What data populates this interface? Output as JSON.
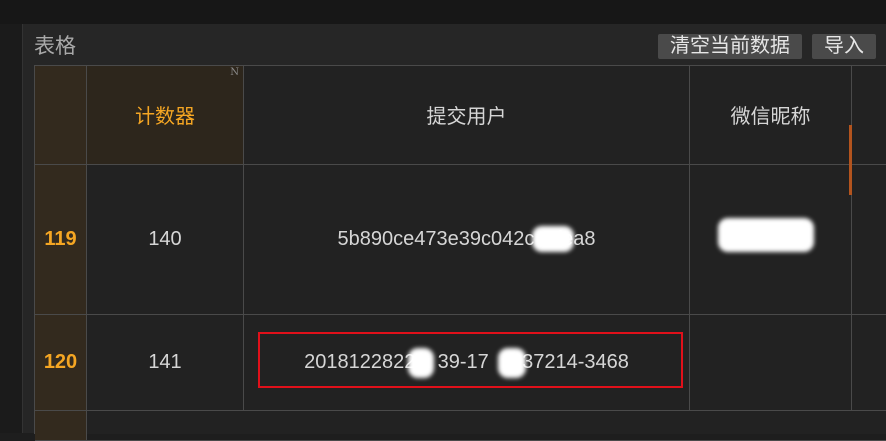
{
  "section": {
    "title": "表格"
  },
  "toolbar": {
    "clear_label": "清空当前数据",
    "import_label": "导入"
  },
  "table": {
    "headers": {
      "counter": "计数器",
      "counter_mark": "N",
      "submitter": "提交用户",
      "wechat_nick": "微信昵称"
    },
    "rows": [
      {
        "index": "119",
        "counter": "140",
        "submitter": "5b890ce473e39c042c    fea8",
        "wechat_nick": ""
      },
      {
        "index": "120",
        "counter": "141",
        "submitter": "2018122822    39-17    337214-3468",
        "wechat_nick": ""
      }
    ]
  },
  "colors": {
    "accent": "#f5a623",
    "highlight": "#e0101a",
    "background": "#262626"
  }
}
